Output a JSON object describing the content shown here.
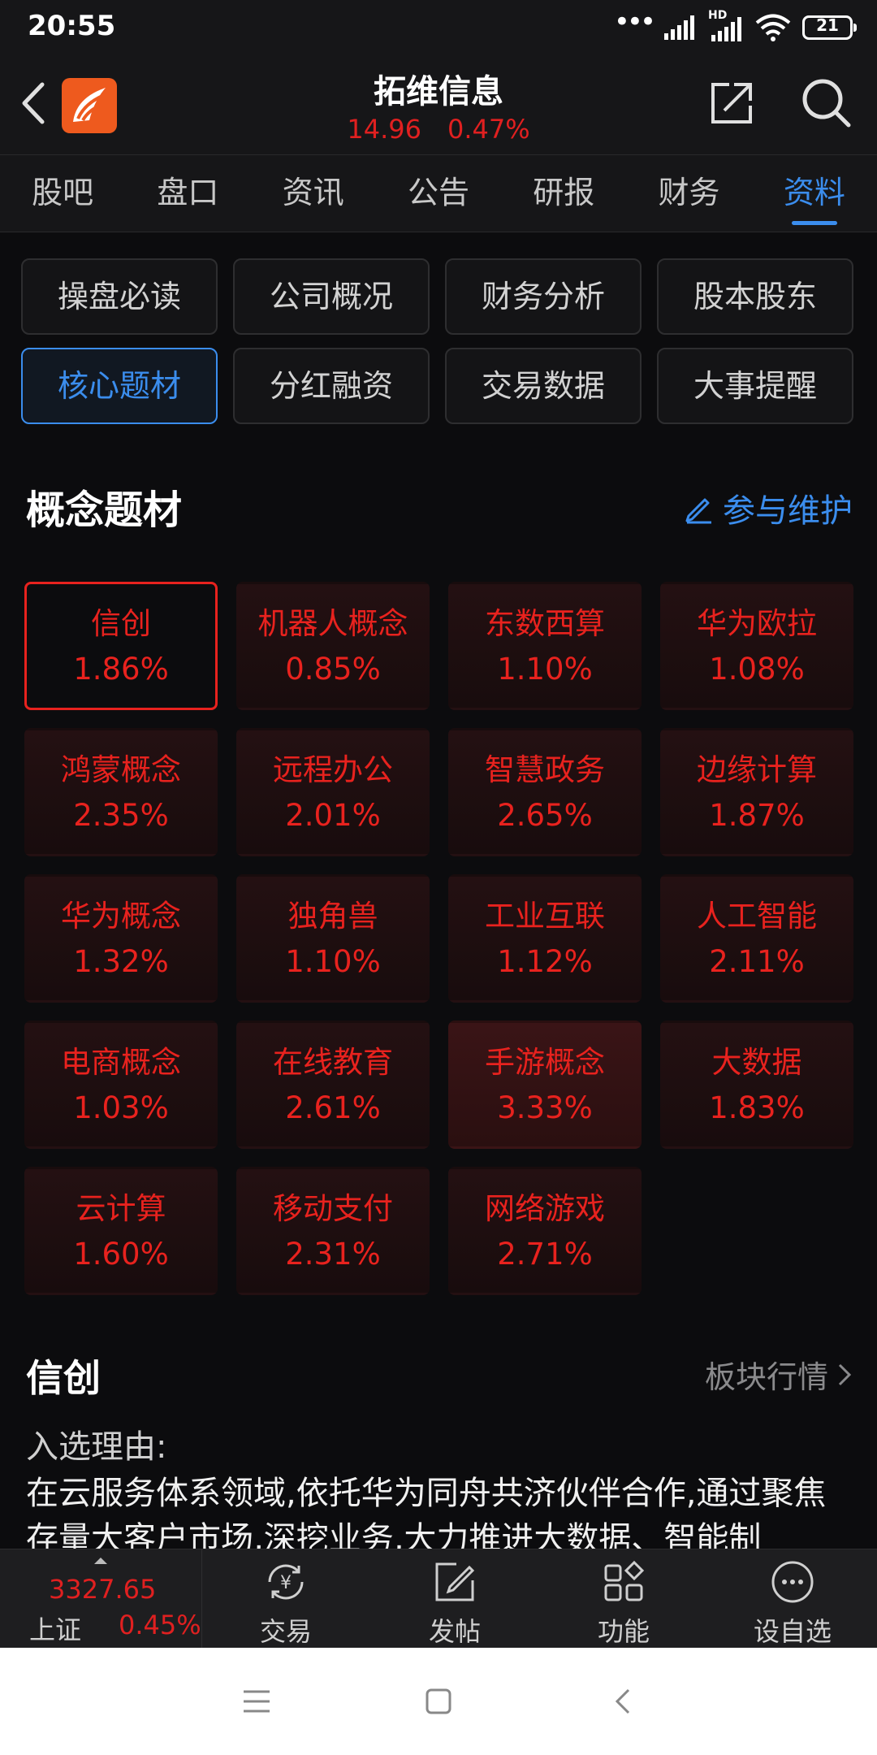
{
  "status_bar": {
    "time": "20:55",
    "network": "HD",
    "battery": "21"
  },
  "header": {
    "title": "拓维信息",
    "price": "14.96",
    "change_pct": "0.47%"
  },
  "tabs": [
    {
      "label": "股吧"
    },
    {
      "label": "盘口"
    },
    {
      "label": "资讯"
    },
    {
      "label": "公告"
    },
    {
      "label": "研报"
    },
    {
      "label": "财务"
    },
    {
      "label": "资料",
      "active": true
    }
  ],
  "sub_menu": [
    {
      "label": "操盘必读"
    },
    {
      "label": "公司概况"
    },
    {
      "label": "财务分析"
    },
    {
      "label": "股本股东"
    },
    {
      "label": "核心题材",
      "active": true
    },
    {
      "label": "分红融资"
    },
    {
      "label": "交易数据"
    },
    {
      "label": "大事提醒"
    }
  ],
  "concept_section": {
    "title": "概念题材",
    "maintain_label": "参与维护"
  },
  "concepts": [
    {
      "name": "信创",
      "pct": "1.86%"
    },
    {
      "name": "机器人概念",
      "pct": "0.85%"
    },
    {
      "name": "东数西算",
      "pct": "1.10%"
    },
    {
      "name": "华为欧拉",
      "pct": "1.08%"
    },
    {
      "name": "鸿蒙概念",
      "pct": "2.35%"
    },
    {
      "name": "远程办公",
      "pct": "2.01%"
    },
    {
      "name": "智慧政务",
      "pct": "2.65%"
    },
    {
      "name": "边缘计算",
      "pct": "1.87%"
    },
    {
      "name": "华为概念",
      "pct": "1.32%"
    },
    {
      "name": "独角兽",
      "pct": "1.10%"
    },
    {
      "name": "工业互联",
      "pct": "1.12%"
    },
    {
      "name": "人工智能",
      "pct": "2.11%"
    },
    {
      "name": "电商概念",
      "pct": "1.03%"
    },
    {
      "name": "在线教育",
      "pct": "2.61%"
    },
    {
      "name": "手游概念",
      "pct": "3.33%"
    },
    {
      "name": "大数据",
      "pct": "1.83%"
    },
    {
      "name": "云计算",
      "pct": "1.60%"
    },
    {
      "name": "移动支付",
      "pct": "2.31%"
    },
    {
      "name": "网络游戏",
      "pct": "2.71%"
    }
  ],
  "detail": {
    "title": "信创",
    "sector_link": "板块行情",
    "reason_label": "入选理由:",
    "reason_text": "在云服务体系领域,依托华为同舟共济伙伴合作,通过聚焦存量大客户市场,深挖业务,大力推进大数据、智能制"
  },
  "bottom_bar": {
    "index_value": "3327.65",
    "index_name": "上证",
    "index_pct": "0.45%",
    "items": [
      {
        "label": "交易",
        "icon": "yuan-exchange-icon"
      },
      {
        "label": "发帖",
        "icon": "edit-post-icon"
      },
      {
        "label": "功能",
        "icon": "grid-apps-icon"
      },
      {
        "label": "设自选",
        "icon": "more-dots-icon"
      }
    ]
  },
  "colors": {
    "accent": "#3b8ded",
    "up": "#e8221e",
    "background": "#0c0c0e"
  }
}
